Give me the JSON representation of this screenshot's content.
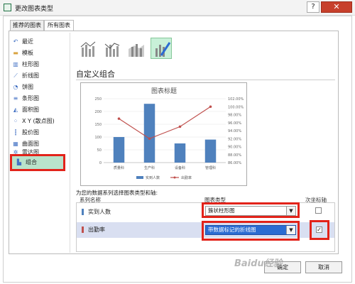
{
  "window": {
    "title": "更改图表类型",
    "help_glyph": "?",
    "close_glyph": "✕"
  },
  "tabs": [
    {
      "label": "推荐的图表"
    },
    {
      "label": "所有图表"
    }
  ],
  "sidebar": {
    "items": [
      {
        "label": "最近",
        "icon": "recent-icon",
        "glyph": "↶"
      },
      {
        "label": "模板",
        "icon": "folder-icon",
        "glyph": "▬"
      },
      {
        "label": "柱形图",
        "icon": "column-chart-icon",
        "glyph": "▥"
      },
      {
        "label": "折线图",
        "icon": "line-chart-icon",
        "glyph": "⟋"
      },
      {
        "label": "饼图",
        "icon": "pie-chart-icon",
        "glyph": "◔"
      },
      {
        "label": "条形图",
        "icon": "bar-chart-icon",
        "glyph": "≡"
      },
      {
        "label": "面积图",
        "icon": "area-chart-icon",
        "glyph": "◭"
      },
      {
        "label": "X Y (散点图)",
        "icon": "scatter-chart-icon",
        "glyph": "⁘"
      },
      {
        "label": "股价图",
        "icon": "stock-chart-icon",
        "glyph": "┇"
      },
      {
        "label": "曲面图",
        "icon": "surface-chart-icon",
        "glyph": "▦"
      },
      {
        "label": "雷达图",
        "icon": "radar-chart-icon",
        "glyph": "✲"
      },
      {
        "label": "组合",
        "icon": "combo-chart-icon",
        "glyph": "▙"
      }
    ],
    "selected": "组合"
  },
  "section_title": "自定义组合",
  "chart_data": {
    "type": "bar",
    "title": "图表标题",
    "categories": [
      "质量科",
      "生产科",
      "设备科",
      "管理科"
    ],
    "series": [
      {
        "name": "实到人数",
        "type": "bar",
        "axis": "primary",
        "values": [
          100,
          230,
          75,
          90
        ]
      },
      {
        "name": "出勤率",
        "type": "line",
        "axis": "secondary",
        "values": [
          0.97,
          0.92,
          0.95,
          1.0
        ]
      }
    ],
    "y_ticks": [
      "0",
      "50",
      "100",
      "150",
      "200",
      "250"
    ],
    "y2_ticks": [
      "86.00%",
      "88.00%",
      "90.00%",
      "92.00%",
      "94.00%",
      "96.00%",
      "98.00%",
      "100.00%",
      "102.00%"
    ],
    "ylim": [
      0,
      250
    ],
    "y2lim": [
      0.86,
      1.02
    ],
    "legend_position": "bottom",
    "grid": true,
    "bar_color": "#4f81bd",
    "line_color": "#c0504d"
  },
  "series_section": {
    "hint": "为您的数据系列选择图表类型和轴:",
    "columns": {
      "name": "系列名称",
      "type": "图表类型",
      "secondary": "次坐标轴"
    },
    "rows": [
      {
        "name": "实到人数",
        "chart_type": "簇状柱形图",
        "secondary": false,
        "color": "#4f81bd"
      },
      {
        "name": "出勤率",
        "chart_type": "带数据标记的折线图",
        "secondary": true,
        "color": "#c0504d"
      }
    ]
  },
  "buttons": {
    "ok": "确定",
    "cancel": "取消"
  },
  "watermark": "Baidu经验"
}
